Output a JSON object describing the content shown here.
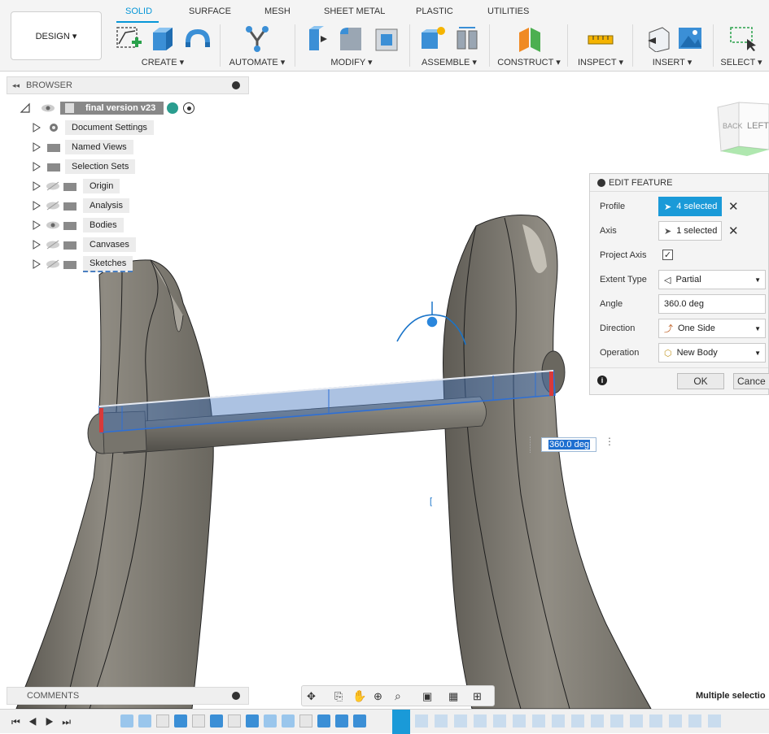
{
  "toolbar": {
    "workspace_label": "DESIGN ▾",
    "tabs": [
      "SOLID",
      "SURFACE",
      "MESH",
      "SHEET METAL",
      "PLASTIC",
      "UTILITIES"
    ],
    "groups": {
      "create": "CREATE ▾",
      "automate": "AUTOMATE ▾",
      "modify": "MODIFY ▾",
      "assemble": "ASSEMBLE ▾",
      "construct": "CONSTRUCT ▾",
      "inspect": "INSPECT ▾",
      "insert": "INSERT ▾",
      "select": "SELECT ▾"
    }
  },
  "browser": {
    "title": "BROWSER",
    "root": "final version v23",
    "items": [
      "Document Settings",
      "Named Views",
      "Selection Sets",
      "Origin",
      "Analysis",
      "Bodies",
      "Canvases",
      "Sketches"
    ]
  },
  "viewcube": {
    "back": "BACK",
    "left": "LEFT"
  },
  "edit_feature": {
    "title": "EDIT FEATURE",
    "rows": {
      "profile": {
        "label": "Profile",
        "value": "4 selected"
      },
      "axis": {
        "label": "Axis",
        "value": "1 selected"
      },
      "project_axis": {
        "label": "Project Axis",
        "checked": true
      },
      "extent_type": {
        "label": "Extent Type",
        "value": "Partial"
      },
      "angle": {
        "label": "Angle",
        "value": "360.0 deg"
      },
      "direction": {
        "label": "Direction",
        "value": "One Side"
      },
      "operation": {
        "label": "Operation",
        "value": "New Body"
      }
    },
    "ok_label": "OK",
    "cancel_label": "Cance"
  },
  "angle_input_value": "360.0 deg",
  "comments": {
    "title": "COMMENTS"
  },
  "status_text": "Multiple selectio",
  "colors": {
    "accent": "#0696d7",
    "selected_blue": "#1a9ad8",
    "body_grey": "#7d7a72"
  }
}
